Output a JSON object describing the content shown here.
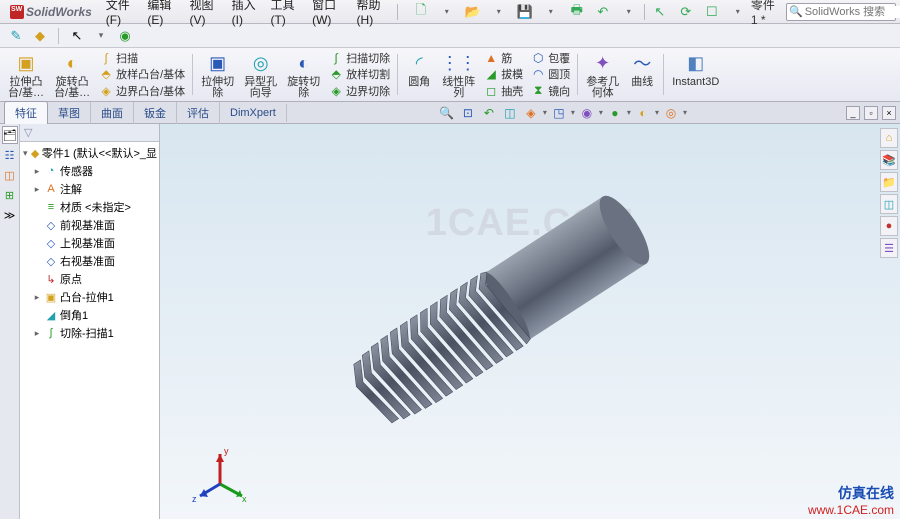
{
  "app": {
    "name": "SolidWorks",
    "doc_title": "零件1 *",
    "search_placeholder": "SolidWorks 搜索"
  },
  "menu": {
    "file": "文件(F)",
    "edit": "编辑(E)",
    "view": "视图(V)",
    "insert": "插入(I)",
    "tools": "工具(T)",
    "window": "窗口(W)",
    "help": "帮助(H)"
  },
  "ribbon": {
    "extrude": "拉伸凸\n台/基…",
    "revolve": "旋转凸\n台/基…",
    "sweep": "扫描",
    "loft": "放样凸台/基体",
    "boundary": "边界凸台/基体",
    "extrude_cut": "拉伸切\n除",
    "hole": "异型孔\n向导",
    "revolve_cut": "旋转切\n除",
    "sweep_cut": "扫描切除",
    "loft_cut": "放样切割",
    "boundary_cut": "边界切除",
    "fillet": "圆角",
    "pattern": "线性阵\n列",
    "rib": "筋",
    "draft": "拔模",
    "shell": "抽壳",
    "wrap": "包覆",
    "dome": "圆顶",
    "mirror": "镜向",
    "refgeom": "参考几\n何体",
    "curves": "曲线",
    "instant3d": "Instant3D"
  },
  "tabs": {
    "features": "特征",
    "sketch": "草图",
    "surface": "曲面",
    "sheetmetal": "钣金",
    "evaluate": "评估",
    "dimxpert": "DimXpert"
  },
  "tree": {
    "root": "零件1  (默认<<默认>_显",
    "sensors": "传感器",
    "annotations": "注解",
    "material": "材质 <未指定>",
    "front": "前视基准面",
    "top": "上视基准面",
    "right": "右视基准面",
    "origin": "原点",
    "extrude1": "凸台-拉伸1",
    "chamfer1": "倒角1",
    "cutsweep1": "切除-扫描1"
  },
  "watermark": "1CAE.COM",
  "source": {
    "cn": "仿真在线",
    "url": "www.1CAE.com"
  },
  "triad_labels": {
    "x": "x",
    "y": "y",
    "z": "z"
  }
}
